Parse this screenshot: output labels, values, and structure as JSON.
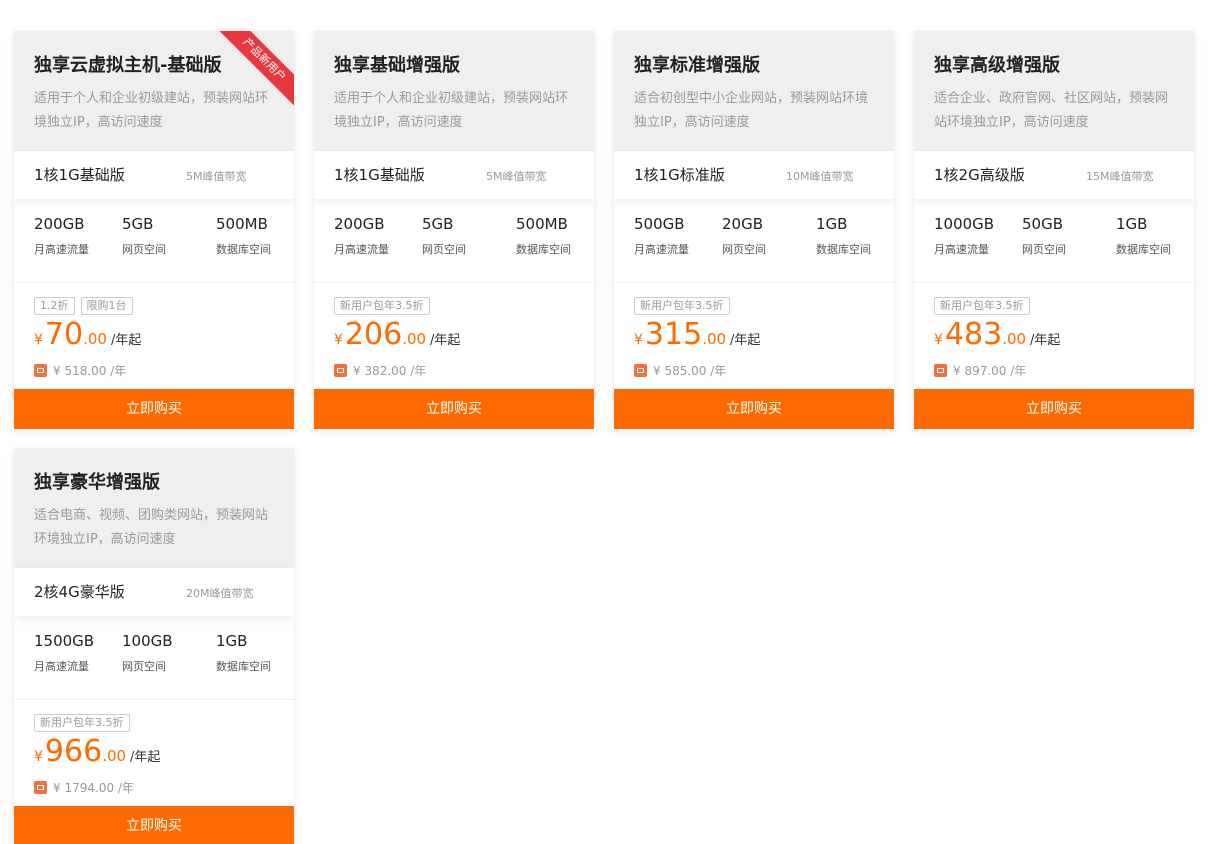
{
  "buy_label": "立即购买",
  "currency": "¥",
  "accent_color": "#ff6a00",
  "products": [
    {
      "title": "独享云虚拟主机-基础版",
      "desc": "适用于个人和企业初级建站，预装网站环境独立IP，高访问速度",
      "ribbon": "产品新用户",
      "spec": "1核1G基础版",
      "bandwidth": "5M峰值带宽",
      "stats": [
        {
          "value": "200GB",
          "label": "月高速流量"
        },
        {
          "value": "5GB",
          "label": "网页空间"
        },
        {
          "value": "500MB",
          "label": "数据库空间"
        }
      ],
      "tags": [
        "1.2折",
        "限购1台"
      ],
      "price_int": "70",
      "price_dec": ".00",
      "unit": "/年起",
      "original": "¥ 518.00 /年"
    },
    {
      "title": "独享基础增强版",
      "desc": "适用于个人和企业初级建站，预装网站环境独立IP，高访问速度",
      "spec": "1核1G基础版",
      "bandwidth": "5M峰值带宽",
      "stats": [
        {
          "value": "200GB",
          "label": "月高速流量"
        },
        {
          "value": "5GB",
          "label": "网页空间"
        },
        {
          "value": "500MB",
          "label": "数据库空间"
        }
      ],
      "tags": [
        "新用户包年3.5折"
      ],
      "price_int": "206",
      "price_dec": ".00",
      "unit": "/年起",
      "original": "¥ 382.00 /年"
    },
    {
      "title": "独享标准增强版",
      "desc": "适合初创型中小企业网站，预装网站环境独立IP，高访问速度",
      "spec": "1核1G标准版",
      "bandwidth": "10M峰值带宽",
      "stats": [
        {
          "value": "500GB",
          "label": "月高速流量"
        },
        {
          "value": "20GB",
          "label": "网页空间"
        },
        {
          "value": "1GB",
          "label": "数据库空间"
        }
      ],
      "tags": [
        "新用户包年3.5折"
      ],
      "price_int": "315",
      "price_dec": ".00",
      "unit": "/年起",
      "original": "¥ 585.00 /年"
    },
    {
      "title": "独享高级增强版",
      "desc": "适合企业、政府官网、社区网站，预装网站环境独立IP，高访问速度",
      "spec": "1核2G高级版",
      "bandwidth": "15M峰值带宽",
      "stats": [
        {
          "value": "1000GB",
          "label": "月高速流量"
        },
        {
          "value": "50GB",
          "label": "网页空间"
        },
        {
          "value": "1GB",
          "label": "数据库空间"
        }
      ],
      "tags": [
        "新用户包年3.5折"
      ],
      "price_int": "483",
      "price_dec": ".00",
      "unit": "/年起",
      "original": "¥ 897.00 /年"
    },
    {
      "title": "独享豪华增强版",
      "desc": "适合电商、视频、团购类网站，预装网站环境独立IP，高访问速度",
      "spec": "2核4G豪华版",
      "bandwidth": "20M峰值带宽",
      "stats": [
        {
          "value": "1500GB",
          "label": "月高速流量"
        },
        {
          "value": "100GB",
          "label": "网页空间"
        },
        {
          "value": "1GB",
          "label": "数据库空间"
        }
      ],
      "tags": [
        "新用户包年3.5折"
      ],
      "price_int": "966",
      "price_dec": ".00",
      "unit": "/年起",
      "original": "¥ 1794.00 /年"
    }
  ]
}
